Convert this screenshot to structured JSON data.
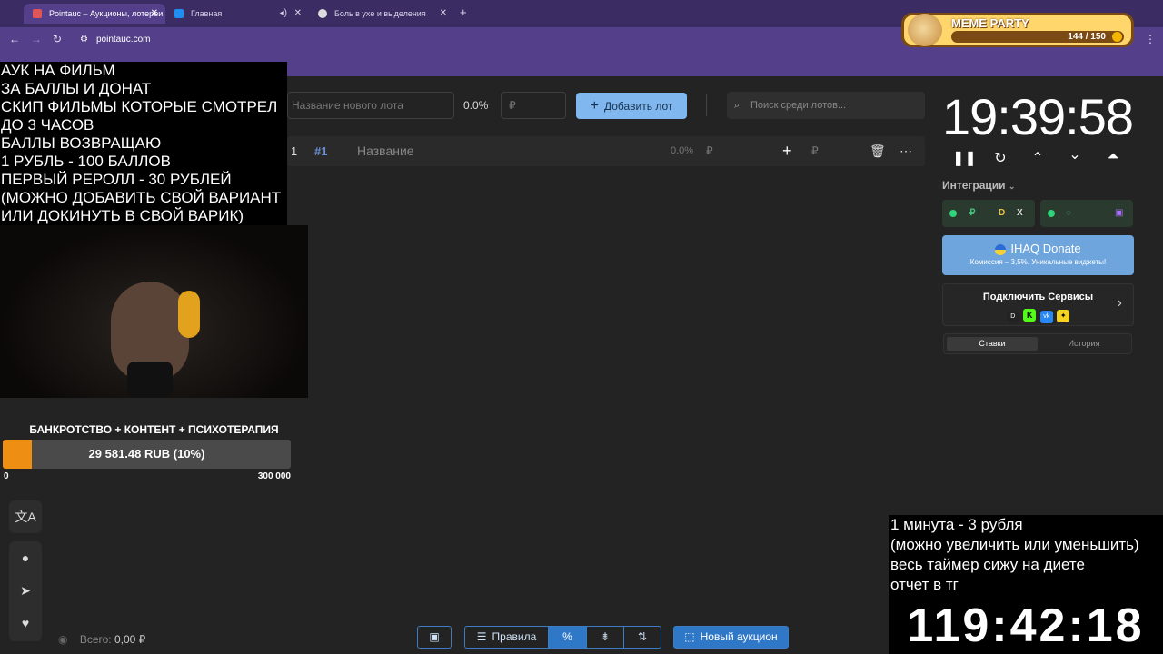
{
  "browser": {
    "tabs": [
      {
        "title": "Pointauc – Аукционы, лотереи"
      },
      {
        "title": "Главная"
      },
      {
        "title": "Боль в ухе и выделения"
      }
    ],
    "url": "pointauc.com",
    "new_tab_symbol": "+"
  },
  "meme_party": {
    "title": "MEME PARTY",
    "count": "144 / 150"
  },
  "stream_overlay": {
    "lines": [
      "АУК НА ФИЛЬМ",
      "ЗА БАЛЛЫ И ДОНАТ",
      "СКИП ФИЛЬМЫ КОТОРЫЕ СМОТРЕЛ",
      "ДО 3 ЧАСОВ",
      "БАЛЛЫ ВОЗВРАЩАЮ",
      "1 РУБЛЬ - 100 БАЛЛОВ",
      "ПЕРВЫЙ РЕРОЛЛ - 30 РУБЛЕЙ",
      "(МОЖНО ДОБАВИТЬ СВОЙ ВАРИАНТ",
      "ИЛИ ДОКИНУТЬ В СВОЙ ВАРИК)"
    ]
  },
  "goal": {
    "title": "БАНКРОТСТВО + КОНТЕНТ + ПСИХОТЕРАПИЯ",
    "amount_label": "29 581.48 RUB (10%)",
    "progress_fraction": 0.1,
    "min": "0",
    "max": "300 000",
    "fill_color": "#ee8e12"
  },
  "lot_form": {
    "name_placeholder": "Название нового лота",
    "percent": "0.0%",
    "amount_placeholder": "₽",
    "add_button": "Добавить лот",
    "search_placeholder": "Поиск среди лотов..."
  },
  "lots": [
    {
      "index": "1",
      "id": "#1",
      "name": "Название",
      "percent": "0.0%",
      "currency": "₽",
      "add_currency": "₽"
    }
  ],
  "timer": {
    "value": "19:39:58"
  },
  "integrations": {
    "label": "Интеграции",
    "donate_title": "IHAQ Donate",
    "donate_subtitle": "Комиссия – 3,5%. Уникальные виджеты!",
    "services_title": "Подключить Сервисы",
    "tabs": [
      "Ставки",
      "История"
    ]
  },
  "bottom_overlay": {
    "lines": [
      "1 минута - 3 рубля",
      "(можно увеличить или уменьшить)",
      "весь таймер сижу на диете",
      "отчет в тг"
    ],
    "timer": "119:42:18"
  },
  "toolbar": {
    "rules_label": "Правила",
    "new_auction_label": "Новый аукцион",
    "balance_label": "Всего:",
    "balance_value": "0,00 ₽"
  },
  "colors": {
    "accent": "#7fb7ee",
    "browser": "#54408a",
    "goal": "#ee8e12"
  }
}
